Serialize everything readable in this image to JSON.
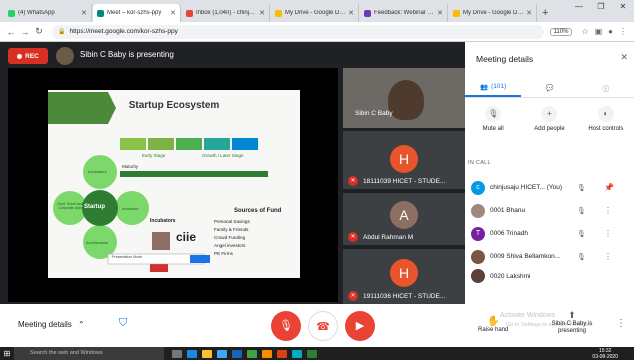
{
  "browser": {
    "tabs": [
      {
        "label": "(4) WhatsApp",
        "color": "#25d366",
        "active": false
      },
      {
        "label": "Meet – kor-szhs-ppy",
        "color": "#00897b",
        "active": true
      },
      {
        "label": "Inbox (1,040) - chinjusaj",
        "color": "#ea4335",
        "active": false
      },
      {
        "label": "My Drive - Google Drive",
        "color": "#fbbc04",
        "active": false
      },
      {
        "label": "Feedback: Webinar on E",
        "color": "#673ab7",
        "active": false
      },
      {
        "label": "My Drive - Google Drive",
        "color": "#fbbc04",
        "active": false
      }
    ],
    "new_tab": "+",
    "url": "https://meet.google.com/kor-szhs-ppy",
    "zoom": "110%"
  },
  "meet": {
    "rec_label": "REC",
    "presenting_text": "Sibin C Baby is presenting",
    "slide": {
      "title": "Startup Ecosystem",
      "stages": [
        "Early Stage",
        "Growth / Later Stage"
      ],
      "maturity": "Maturity",
      "center": "Startup",
      "petals": [
        "Incubators",
        "Investors",
        "Accelerators",
        "Govt. Grant and Corporate Aids"
      ],
      "incubators_heading": "Incubators",
      "funds_heading": "Sources of Fund",
      "funds": [
        "Personal Savings",
        "Family & Friends",
        "Crowd Funding",
        "Angel investors",
        "PE Firms"
      ],
      "logo_text": "ciie",
      "search_text": "Presentation Mode"
    },
    "tiles": [
      {
        "name": "Sibin C Baby",
        "type": "video"
      },
      {
        "name": "18111039 HICET - STUDE...",
        "letter": "H",
        "color": "#e8552a"
      },
      {
        "name": "Abdul Rahman M",
        "letter": "A",
        "color": "#8d6e63"
      },
      {
        "name": "19111036 HICET - STUDE...",
        "letter": "H",
        "color": "#e8552a"
      }
    ]
  },
  "sidebar": {
    "title": "Meeting details",
    "close_icon": "✕",
    "tabs": [
      {
        "label": "(101)",
        "icon": "people-icon",
        "active": true
      },
      {
        "label": "",
        "icon": "chat-icon",
        "active": false
      },
      {
        "label": "",
        "icon": "info-icon",
        "active": false
      }
    ],
    "actions": [
      {
        "label": "Mute all"
      },
      {
        "label": "Add people"
      },
      {
        "label": "Host controls"
      }
    ],
    "in_call_label": "IN CALL",
    "participants": [
      {
        "name": "chinjusaju HICET... (You)",
        "letter": "c",
        "color": "#039be5"
      },
      {
        "name": "0001 Bhanu",
        "letter": "",
        "color": "#a1887f"
      },
      {
        "name": "0006 Trinadh",
        "letter": "T",
        "color": "#7b1fa2"
      },
      {
        "name": "0009 Shiva Bellamkon...",
        "letter": "",
        "color": "#795548"
      },
      {
        "name": "0020 Lakshmi",
        "letter": "",
        "color": "#5d4037"
      }
    ]
  },
  "controls": {
    "meeting_details_label": "Meeting details",
    "raise_hand_label": "Raise hand",
    "presenting_label": "Sibin C Baby is presenting",
    "watermark_line1": "Activate Windows",
    "watermark_line2": "Go to Settings to activate Windows."
  },
  "taskbar": {
    "search_placeholder": "Search the web and Windows",
    "time": "15:32",
    "date": "03-08-2020"
  }
}
